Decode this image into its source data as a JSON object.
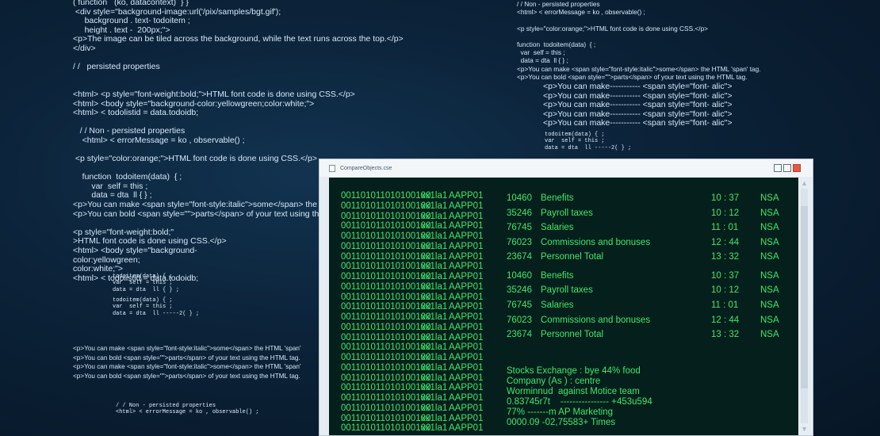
{
  "background_code": {
    "top_left": [
      "( function   (ko, datacontext)  } }",
      " <div style=\"background-image:url('/pix/samples/bgt.gif');",
      "     background . text- todoitem ;",
      "     height . text -  200px;\">",
      "<p>The image can be tiled across the background, while the text runs across the top.</p>",
      "</div>",
      "",
      "/ /   persisted properties",
      "",
      "",
      "<html> <p style=\"font-weight:bold;\">HTML font code is done using CSS.</p>",
      "<html> <body style=\"background-color:yellowgreen;color:white;\">",
      "<html> < todolistid = data.todoidb;",
      "",
      "   / / Non - persisted properties",
      "    <html> < errorMessage = ko , observable() ;",
      "",
      " <p style=\"color:orange;\">HTML font code is done using CSS.</p>",
      "",
      "    function  todoitem(data)  { ;",
      "        var  self = this ;",
      "        data = dta  ll { } ;",
      "<p>You can make <span style=\"font-style:italic\">some</span> the HTML",
      "<p>You can bold <span style=\"\">parts</span> of your text using the",
      "",
      "<p style=\"font-weight:bold;\"",
      ">HTML font code is done using CSS.</p>",
      "<html> <body style=\"background-",
      "color:yellowgreen;",
      "color:white;\">",
      "<html> < todolistid = data.todoidb;"
    ],
    "mono_left_1": [
      "todoitem(data) { ;",
      "var  self = this ;",
      "data = dta  ll { } ;"
    ],
    "mono_left_2": [
      "todoitem(data) { ;",
      "var  self = this ;",
      "data = dta  ll -----2( } ;"
    ],
    "bottom_left": [
      "<p>You can make <span style=\"font-style:italic\">some</span> the HTML 'span'",
      "<p>You can bold <span style=\"\">parts</span> of your text using the HTML tag.",
      "<p>You can make <span style=\"font-style:italic\">some</span> the HTML 'span'",
      "<p>You can bold <span style=\"\">parts</span> of your text using the HTML tag."
    ],
    "mono_bottom": [
      "/ / Non - persisted properties",
      "<html> < errorMessage = ko , observable() ;"
    ],
    "top_right": [
      "/ / Non - persisted properties",
      "<html> < errorMessage = ko , observable() ;",
      "",
      "<p style=\"color:orange;\">HTML font code is done using CSS.</p>",
      "",
      "function  todoitem(data)  { ;",
      "  var  self = this ;",
      "  data = dta  ll { } ;",
      "<p>You can make <span style=\"font-style:italic\">some</span> the HTML 'span' tag.",
      "<p>You can bold <span style=\"\">parts</span> of your text using the HTML tag."
    ],
    "right_list": [
      "<p>You can make----------- <span style=\"font- alic\">",
      "<p>You can make----------- <span style=\"font- alic\">",
      "<p>You can make----------- <span style=\"font- alic\">",
      "<p>You can make----------- <span style=\"font- alic\">",
      "<p>You can make----------- <span style=\"font- alic\">"
    ],
    "mono_right": [
      "todoitem(data) { ;",
      "var  self = this ;",
      "data = dta  ll -----2( } ;"
    ]
  },
  "window": {
    "title": "CompareObjects.cse",
    "binary_rows": [
      [
        "001101011010100100",
        "xx1la1",
        "AAPP01"
      ],
      [
        "001101011010100100",
        "xx1la1",
        "AAPP01"
      ],
      [
        "001101011010100100",
        "xx1la1",
        "AAPP01"
      ],
      [
        "001101011010100100",
        "xx1la1",
        "AAPP01"
      ],
      [
        "001101011010100100",
        "xx1la1",
        "AAPP01"
      ],
      [
        "001101011010100100",
        "xx1la1",
        "AAPP01"
      ],
      [
        "001101011010100100",
        "xx1la1",
        "AAPP01"
      ],
      [
        "001101011010100100",
        "xx1la1",
        "AAPP01"
      ],
      [
        "001101011010100100",
        "xx1la1",
        "AAPP01"
      ],
      [
        "001101011010100100",
        "xx1la1",
        "AAPP01"
      ],
      [
        "001101011010100100",
        "xx1la1",
        "AAPP01"
      ],
      [
        "001101011010100100",
        "xx1la1",
        "AAPP01"
      ],
      [
        "001101011010100100",
        "xx1la1",
        "AAPP01"
      ],
      [
        "001101011010100100",
        "xx1la1",
        "AAPP01"
      ],
      [
        "001101011010100100",
        "xx1la1",
        "AAPP01"
      ],
      [
        "001101011010100100",
        "xx1la1",
        "AAPP01"
      ],
      [
        "001101011010100100",
        "xx1la1",
        "AAPP01"
      ],
      [
        "001101011010100100",
        "xx1la1",
        "AAPP01"
      ],
      [
        "001101011010100100",
        "xx1la1",
        "AAPP01"
      ],
      [
        "001101011010100100",
        "xx1la1",
        "AAPP01"
      ],
      [
        "001101011010100100",
        "xx1la1",
        "AAPP01"
      ],
      [
        "001101011010100100",
        "xx1la1",
        "AAPP01"
      ],
      [
        "001101011010100100",
        "xx1la1",
        "AAPP01"
      ],
      [
        "001101011010100100",
        "xx1la1",
        "AAPP01"
      ]
    ],
    "records": [
      [
        "10460",
        "Benefits",
        "10 : 37",
        "NSA"
      ],
      [
        "35246",
        "Payroll taxes",
        "10 : 12",
        "NSA"
      ],
      [
        "76745",
        "Salaries",
        "11 : 01",
        "NSA"
      ],
      [
        "76023",
        "Commissions and bonuses",
        "12 : 44",
        "NSA"
      ],
      [
        "23674",
        "Personnel Total",
        "13 : 32",
        "NSA"
      ],
      [
        "10460",
        "Benefits",
        "10 : 37",
        "NSA"
      ],
      [
        "35246",
        "Payroll taxes",
        "10 : 12",
        "NSA"
      ],
      [
        "76745",
        "Salaries",
        "11 : 01",
        "NSA"
      ],
      [
        "76023",
        "Commissions and bonuses",
        "12 : 44",
        "NSA"
      ],
      [
        "23674",
        "Personnel Total",
        "13 : 32",
        "NSA"
      ]
    ],
    "notes": [
      "Stocks Exchange : bye 44% food",
      "Company (As ) : centre",
      "Worminnud  against Motice team",
      "0.83745r7t    ---------------- +453u594",
      "77% -------m AP Marketing",
      "0000.09 -02,75583+ Times"
    ]
  },
  "colors": {
    "terminal_text": "#3fe86a",
    "terminal_bg": "#041f1c",
    "close_button": "#e25a45"
  }
}
